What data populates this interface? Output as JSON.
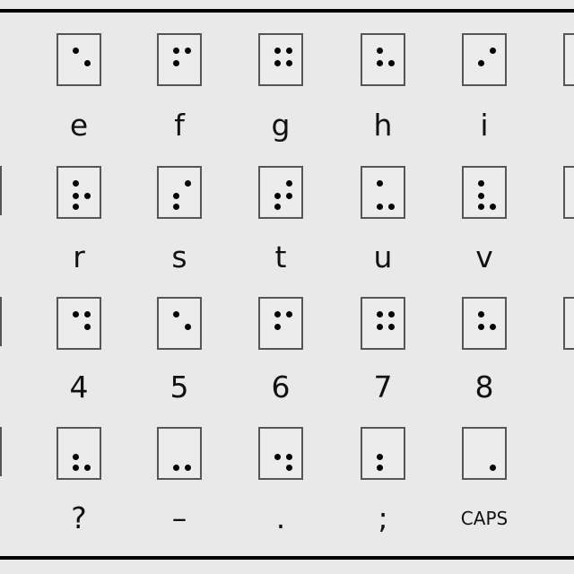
{
  "rows": [
    {
      "cells": [
        {
          "label": "e",
          "dots": [
            1,
            5
          ]
        },
        {
          "label": "f",
          "dots": [
            1,
            2,
            4
          ]
        },
        {
          "label": "g",
          "dots": [
            1,
            2,
            4,
            5
          ]
        },
        {
          "label": "h",
          "dots": [
            1,
            2,
            5
          ]
        },
        {
          "label": "i",
          "dots": [
            2,
            4
          ]
        }
      ]
    },
    {
      "cells": [
        {
          "label": "r",
          "dots": [
            1,
            2,
            3,
            5
          ]
        },
        {
          "label": "s",
          "dots": [
            2,
            3,
            4
          ]
        },
        {
          "label": "t",
          "dots": [
            2,
            3,
            4,
            5
          ]
        },
        {
          "label": "u",
          "dots": [
            1,
            3,
            6
          ]
        },
        {
          "label": "v",
          "dots": [
            1,
            2,
            3,
            6
          ]
        }
      ]
    },
    {
      "cells": [
        {
          "label": "4",
          "dots": [
            1,
            4,
            5
          ]
        },
        {
          "label": "5",
          "dots": [
            1,
            5
          ]
        },
        {
          "label": "6",
          "dots": [
            1,
            2,
            4
          ]
        },
        {
          "label": "7",
          "dots": [
            1,
            2,
            4,
            5
          ]
        },
        {
          "label": "8",
          "dots": [
            1,
            2,
            5
          ]
        }
      ]
    },
    {
      "cells": [
        {
          "label": "?",
          "dots": [
            2,
            3,
            6
          ]
        },
        {
          "label": "–",
          "dots": [
            3,
            6
          ]
        },
        {
          "label": ".",
          "dots": [
            2,
            5,
            6
          ]
        },
        {
          "label": ";",
          "dots": [
            2,
            3
          ]
        },
        {
          "label": "CAPS",
          "dots": [
            6
          ]
        }
      ]
    }
  ],
  "colors": {
    "background": "#e9e9e9",
    "dot": "#000000",
    "cell_border": "#555555"
  }
}
